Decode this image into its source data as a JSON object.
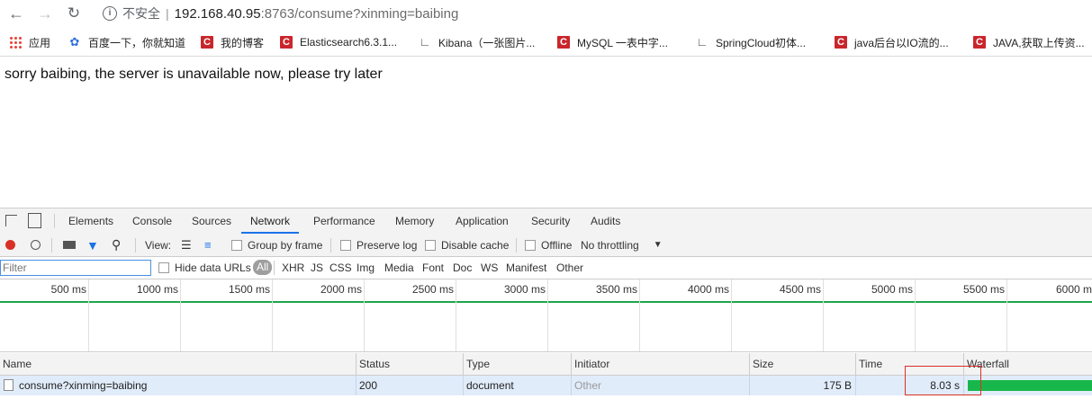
{
  "browser": {
    "insecure_label": "不安全",
    "url_host": "192.168.40.95",
    "url_rest": ":8763/consume?xinming=baibing"
  },
  "bookmarks": [
    {
      "icon": "apps-icon",
      "label": "应用"
    },
    {
      "icon": "baidu-paw-icon",
      "label": "百度一下，你就知道"
    },
    {
      "icon": "csdn-icon",
      "label": "我的博客"
    },
    {
      "icon": "csdn-icon",
      "label": "Elasticsearch6.3.1..."
    },
    {
      "icon": "kibana-icon",
      "label": "Kibana（一张图片..."
    },
    {
      "icon": "csdn-icon",
      "label": "MySQL 一表中字..."
    },
    {
      "icon": "kibana-icon",
      "label": "SpringCloud初体..."
    },
    {
      "icon": "csdn-icon",
      "label": "java后台以IO流的..."
    },
    {
      "icon": "csdn-icon",
      "label": "JAVA,获取上传资..."
    }
  ],
  "page": {
    "message": "sorry baibing, the server is unavailable now, please try later"
  },
  "devtools": {
    "tabs": [
      "Elements",
      "Console",
      "Sources",
      "Network",
      "Performance",
      "Memory",
      "Application",
      "Security",
      "Audits"
    ],
    "active_tab": "Network",
    "toolbar": {
      "view_label": "View:",
      "group_by_frame": "Group by frame",
      "preserve_log": "Preserve log",
      "disable_cache": "Disable cache",
      "offline": "Offline",
      "throttling": "No throttling"
    },
    "filter": {
      "placeholder": "Filter",
      "hide_data_urls": "Hide data URLs",
      "types": [
        "All",
        "XHR",
        "JS",
        "CSS",
        "Img",
        "Media",
        "Font",
        "Doc",
        "WS",
        "Manifest",
        "Other"
      ]
    },
    "timeline_ticks": [
      "500 ms",
      "1000 ms",
      "1500 ms",
      "2000 ms",
      "2500 ms",
      "3000 ms",
      "3500 ms",
      "4000 ms",
      "4500 ms",
      "5000 ms",
      "5500 ms",
      "6000 m"
    ],
    "columns": [
      "Name",
      "Status",
      "Type",
      "Initiator",
      "Size",
      "Time",
      "Waterfall"
    ],
    "rows": [
      {
        "name": "consume?xinming=baibing",
        "status": "200",
        "type": "document",
        "initiator": "Other",
        "size": "175 B",
        "time": "8.03 s"
      }
    ]
  },
  "colors": {
    "accent": "#1a73e8",
    "record": "#d93025",
    "waterfall": "#18b74b",
    "selected_row": "#e1ecfa"
  }
}
